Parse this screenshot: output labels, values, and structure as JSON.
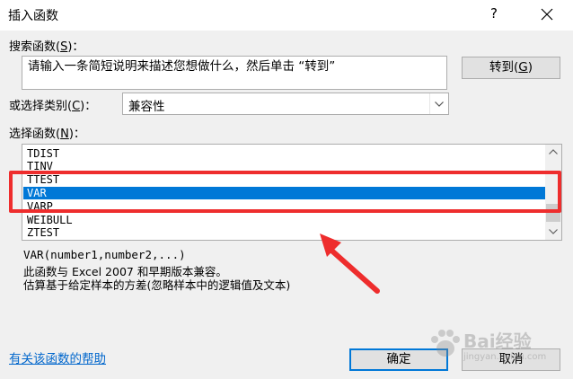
{
  "window": {
    "title": "插入函数",
    "help_label": "?",
    "close_label": "✕"
  },
  "search": {
    "label": "搜索函数(S)：",
    "label_pre": "搜索函数(",
    "label_key": "S",
    "label_post": ")：",
    "text": "请输入一条简短说明来描述您想做什么，然后单击 “转到”",
    "go_label": "转到(G)",
    "go_pre": "转到(",
    "go_key": "G",
    "go_post": ")"
  },
  "category": {
    "label_pre": "或选择类别(",
    "label_key": "C",
    "label_post": ")：",
    "selected": "兼容性"
  },
  "functions": {
    "label_pre": "选择函数(",
    "label_key": "N",
    "label_post": ")：",
    "items": [
      "TDIST",
      "TINV",
      "TTEST",
      "VAR",
      "VARP",
      "WEIBULL",
      "ZTEST"
    ],
    "selected": "VAR"
  },
  "description": {
    "signature": "VAR(number1,number2,...)",
    "line1": "此函数与 Excel 2007 和早期版本兼容。",
    "line2": "估算基于给定样本的方差(忽略样本中的逻辑值及文本)"
  },
  "footer": {
    "help_link": "有关该函数的帮助",
    "ok_label": "确定",
    "cancel_label": "取消"
  },
  "colors": {
    "selection": "#0078d7",
    "annotation": "#ee2d2d",
    "link": "#0066cc"
  },
  "annotation": {
    "type": "red-box-with-arrow"
  },
  "watermark": {
    "text": "Bai经验",
    "sub": "jingyan.baidu.com"
  }
}
